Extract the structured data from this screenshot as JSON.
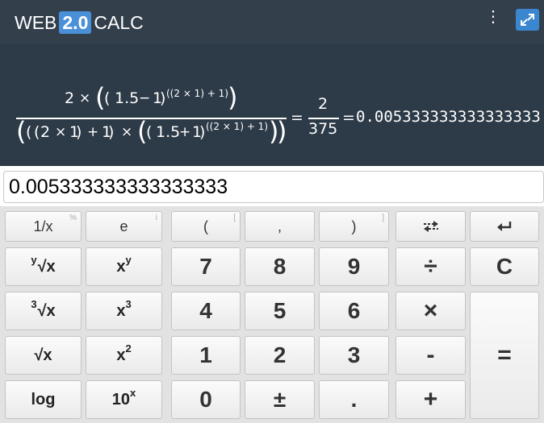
{
  "header": {
    "logo_web": "WEB",
    "logo_version": "2.0",
    "logo_calc": "CALC",
    "menu_icon": "kebab-menu-icon",
    "expand_icon": "expand-icon"
  },
  "display": {
    "num_2": "2",
    "times": "×",
    "lparen": "(",
    "rparen": ")",
    "n_1_5": "1.5",
    "minus": "−",
    "one": "1",
    "exp": "((2 × 1) + 1)",
    "plus": "+",
    "frac_num": "2",
    "frac_den": "375",
    "equals": "=",
    "decimal": "0.005333333333333333"
  },
  "input": {
    "value": "0.005333333333333333"
  },
  "keypad": {
    "inv": "1/x",
    "inv_hint": "%",
    "e": "e",
    "e_hint": "i",
    "lparen": "(",
    "lparen_hint": "[",
    "comma": ",",
    "rparen": ")",
    "rparen_hint": "]",
    "swap_icon": "swap-arrows-icon",
    "back_icon": "return-arrow-icon",
    "root_y_pre": "y",
    "root_y": "√x",
    "pow_y_base": "x",
    "pow_y_sup": "y",
    "seven": "7",
    "eight": "8",
    "nine": "9",
    "divide": "÷",
    "clear": "C",
    "root3_pre": "3",
    "root3": "√x",
    "pow3_base": "x",
    "pow3_sup": "3",
    "four": "4",
    "five": "5",
    "six": "6",
    "multiply": "×",
    "sqrt": "√x",
    "pow2_base": "x",
    "pow2_sup": "2",
    "one": "1",
    "two": "2",
    "three": "3",
    "minus": "-",
    "equals": "=",
    "log": "log",
    "ten_base": "10",
    "ten_sup": "x",
    "zero": "0",
    "plusminus": "±",
    "dot": ".",
    "plus": "+"
  }
}
